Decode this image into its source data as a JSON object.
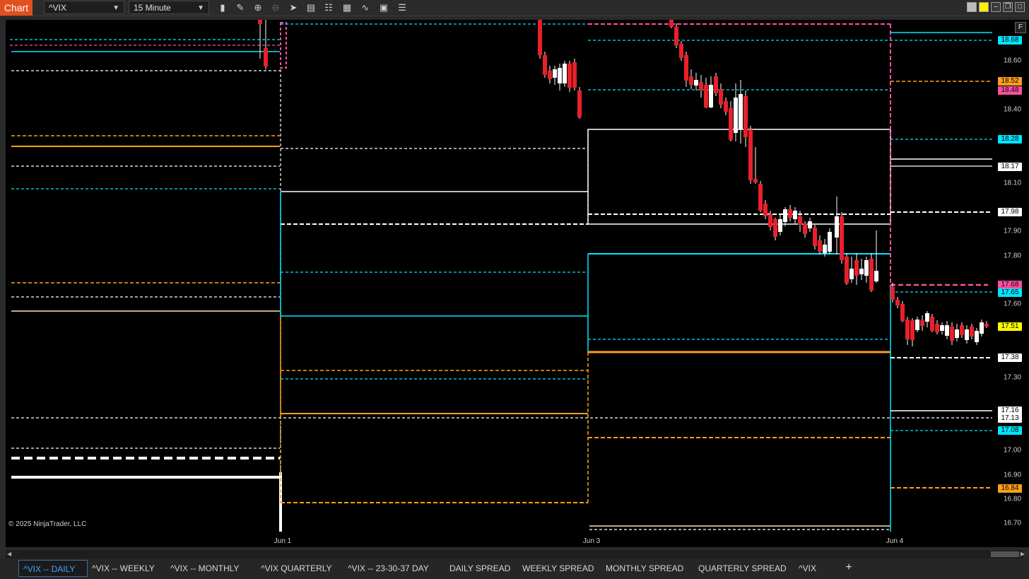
{
  "toolbar": {
    "chart_badge": "Chart",
    "instrument": "^VIX",
    "interval": "15 Minute",
    "icons": [
      "bar-type-icon",
      "draw-pencil-icon",
      "zoom-in-icon",
      "zoom-out-icon",
      "pointer-icon",
      "data-box-icon",
      "properties-icon",
      "indicators-icon",
      "strategies-icon",
      "templates-icon",
      "list-icon"
    ]
  },
  "window_buttons": [
    "grey-theme-icon",
    "yellow-theme-icon",
    "minimize-icon",
    "restore-icon",
    "maximize-icon",
    "close-icon"
  ],
  "chart": {
    "copyright": "© 2025 NinjaTrader, LLC",
    "f_button": "F",
    "time_labels": [
      "Jun 1",
      "Jun 3",
      "Jun 4"
    ],
    "price_ticks": [
      "18.60",
      "18.40",
      "18.10",
      "17.90",
      "17.80",
      "17.60",
      "17.30",
      "17.00",
      "16.90",
      "16.80",
      "16.70"
    ],
    "price_labels": [
      {
        "text": "18.68",
        "color": "#00e5ff"
      },
      {
        "text": "18.52",
        "color": "#ff9f1a"
      },
      {
        "text": "18.48",
        "color": "#ff4fa3"
      },
      {
        "text": "18.28",
        "color": "#00e5ff"
      },
      {
        "text": "18.17",
        "color": "#ffffff"
      },
      {
        "text": "17.98",
        "color": "#ffffff"
      },
      {
        "text": "17.68",
        "color": "#ff4fa3"
      },
      {
        "text": "17.65",
        "color": "#00e5ff"
      },
      {
        "text": "17.51",
        "color": "#ffff00"
      },
      {
        "text": "17.38",
        "color": "#ffffff"
      },
      {
        "text": "17.16",
        "color": "#ffffff"
      },
      {
        "text": "17.13",
        "color": "#ffffff"
      },
      {
        "text": "17.08",
        "color": "#00e5ff"
      },
      {
        "text": "16.84",
        "color": "#ff9f1a"
      }
    ]
  },
  "tabs": [
    "^VIX -- DAILY",
    "^VIX -- WEEKLY",
    "^VIX -- MONTHLY",
    "^VIX QUARTERLY",
    "^VIX -- 23-30-37 DAY",
    "DAILY SPREAD",
    "WEEKLY SPREAD",
    "MONTHLY SPREAD",
    "QUARTERLY SPREAD",
    "^VIX"
  ],
  "add_tab": "+"
}
